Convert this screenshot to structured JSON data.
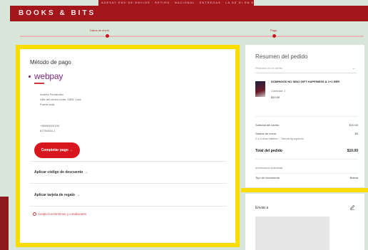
{
  "banner": {
    "text": "ADESAT·ENV·DE·ENVIOS · RETIRO · NACIONAL · ENTREGAS · LA DE DI EN ELAS"
  },
  "header": {
    "brand": "BOOKS & BITS"
  },
  "progress": {
    "steps": [
      {
        "label": "Datos de envío"
      },
      {
        "label": "Pago"
      }
    ]
  },
  "payment": {
    "title": "Método de pago",
    "provider": "webpay",
    "address_lines": [
      "Andrés Fernández",
      "Villa del centro norte, 1805, Lota",
      "Puerta sola"
    ],
    "contact_lines": [
      "+56999000198",
      "87754463-1"
    ],
    "pay_button": "Completar pago →",
    "discount_label": "Aplicar código de descuento",
    "giftcard_label": "Aplicar tarjeta de regalo",
    "terms_text": "Acepto los términos y condiciones",
    "chevron": "⌄"
  },
  "summary": {
    "title": "Resumen del pedido",
    "select_text": "Producto en el carrito",
    "item": {
      "title": "DOMINGOS NO SINO GIFT HAPPINESS & 1+1 HER",
      "subtitle": "Cantidad: 1",
      "price": "$10.00"
    },
    "subtotal_label": "Subtotal del carrito",
    "subtotal_value": "$10.00",
    "shipping_label": "Gastos de envío",
    "shipping_value": "$0",
    "shipping_detail": "2 a 5 días hábiles – Tienda Apoquindo",
    "total_label": "Total del pedido",
    "total_value": "$10.00",
    "extra_info": "Información Adicional",
    "doc_label": "Tipo de documento",
    "doc_value": "Boleta"
  },
  "send": {
    "label": "Enviar a"
  }
}
